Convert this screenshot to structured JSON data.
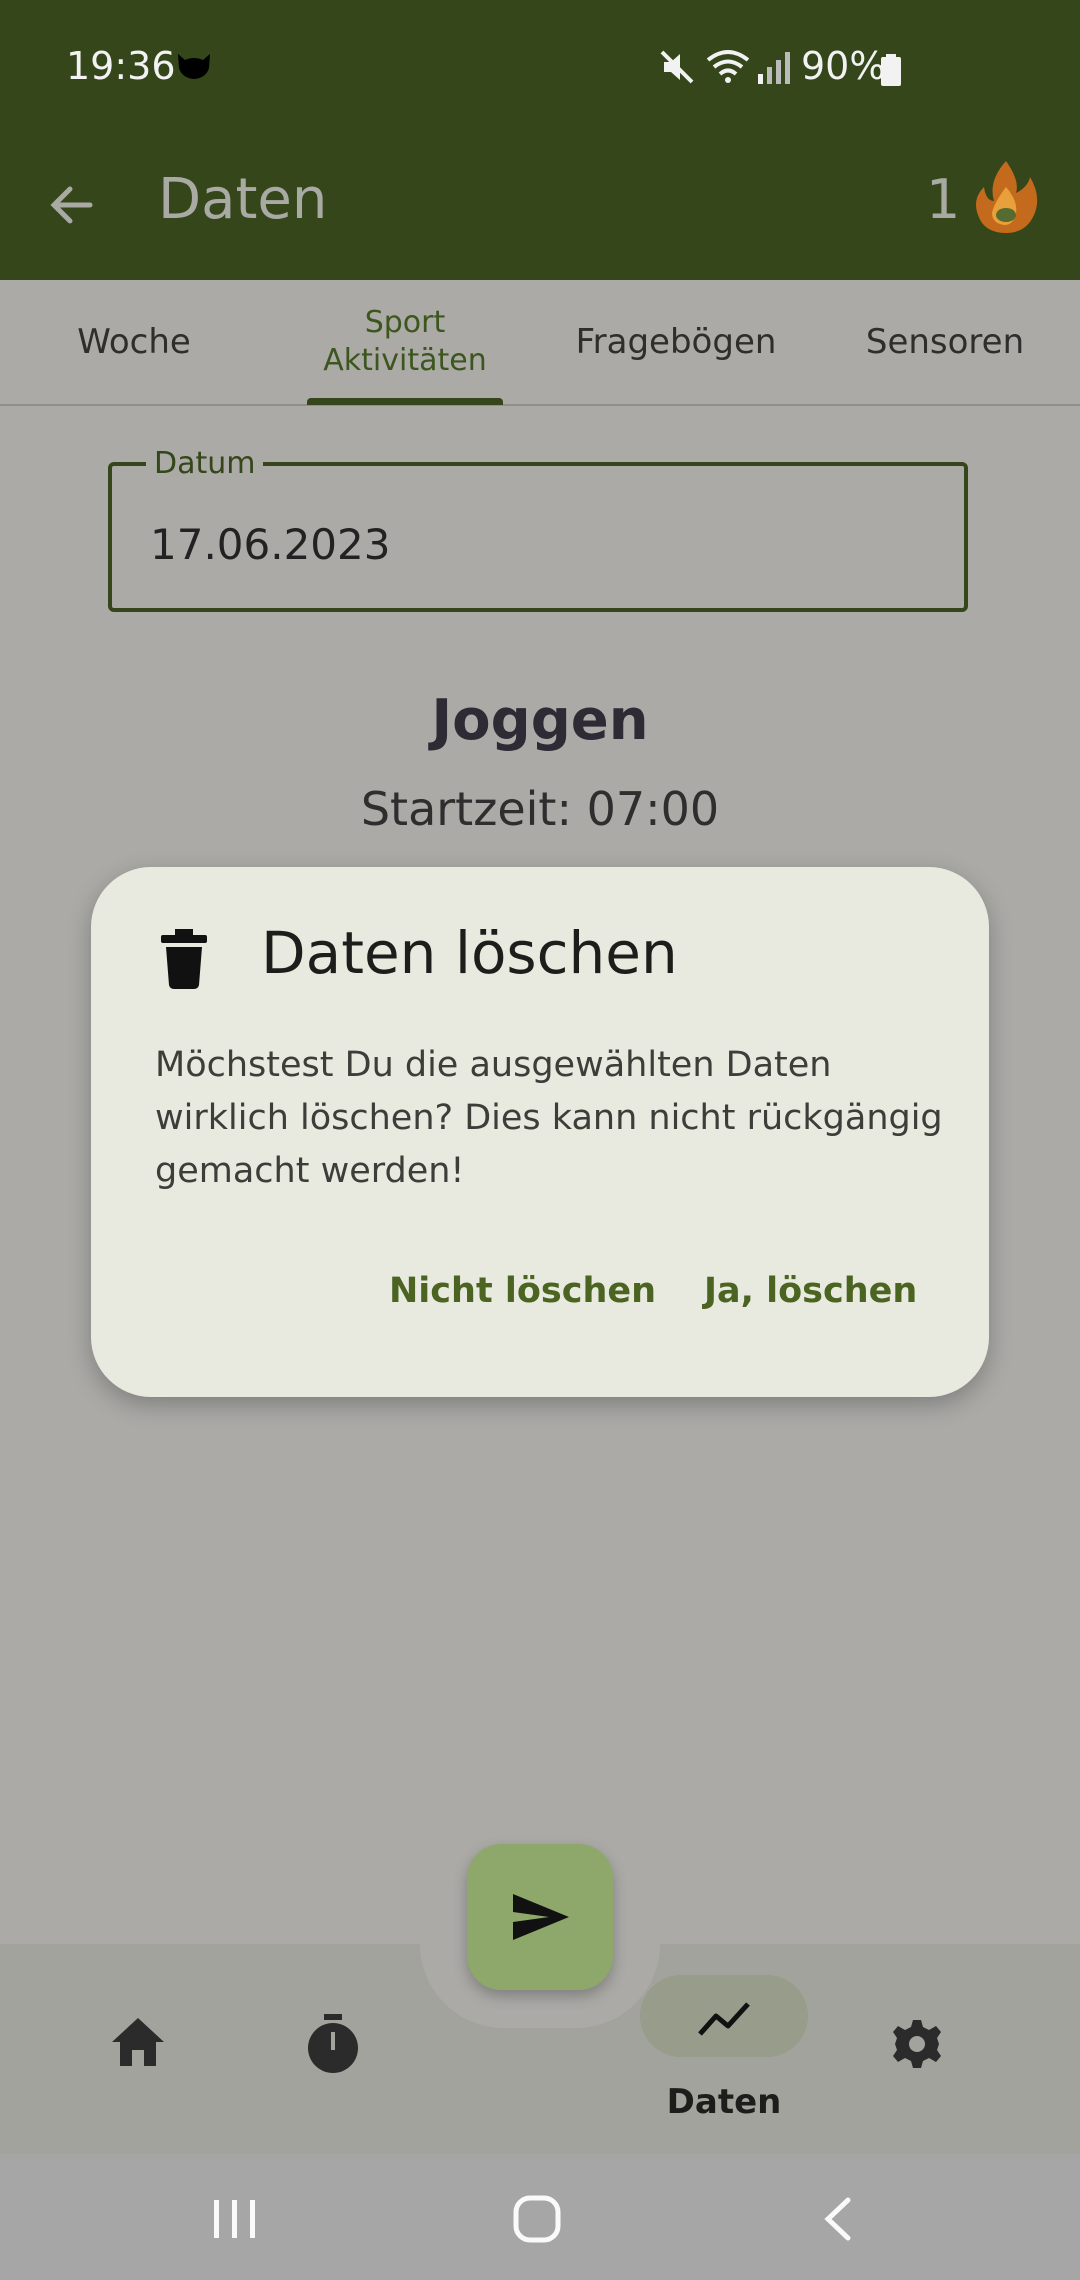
{
  "status_bar": {
    "time": "19:36",
    "battery": "90%"
  },
  "app_bar": {
    "title": "Daten",
    "streak_count": "1"
  },
  "tabs": [
    {
      "label": "Woche"
    },
    {
      "label": "Sport\nAktivitäten"
    },
    {
      "label": "Fragebögen"
    },
    {
      "label": "Sensoren"
    }
  ],
  "date_field": {
    "label": "Datum",
    "value": "17.06.2023"
  },
  "activity": {
    "name": "Joggen",
    "start": "Startzeit: 07:00"
  },
  "dialog": {
    "title": "Daten löschen",
    "body": "Möchstest Du die ausgewählten Daten wirklich löschen? Dies kann nicht rückgängig gemacht werden!",
    "cancel_label": "Nicht löschen",
    "confirm_label": "Ja, löschen"
  },
  "bottom_nav": {
    "active_label": "Daten"
  },
  "colors": {
    "primary": "#34461a",
    "accent": "#4c6422",
    "fab": "#8ea86b",
    "dialog_bg": "#e9eadf"
  }
}
